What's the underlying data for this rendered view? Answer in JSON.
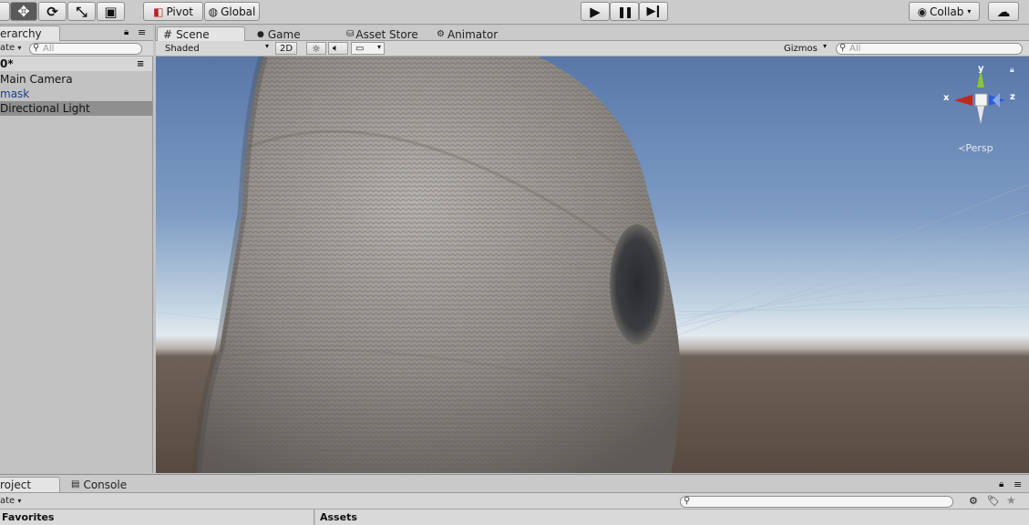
{
  "toolbar": {
    "tools": [
      {
        "name": "hand-tool",
        "glyph": "✋"
      },
      {
        "name": "move-tool",
        "glyph": "✥"
      },
      {
        "name": "rotate-tool",
        "glyph": "⟳"
      },
      {
        "name": "scale-tool",
        "glyph": "⤡"
      },
      {
        "name": "rect-tool",
        "glyph": "▣"
      }
    ],
    "pivot_label": "Pivot",
    "global_label": "Global",
    "play_glyph": "▶",
    "pause_glyph": "❚❚",
    "step_glyph": "▶❙",
    "collab_label": "Collab",
    "cloud_glyph": "☁"
  },
  "hierarchy": {
    "tab_label": "erarchy",
    "create_label": "ate",
    "search_placeholder": "All",
    "scene_name": "0*",
    "items": [
      {
        "label": "Main Camera",
        "selected": false,
        "prefab": false
      },
      {
        "label": "mask",
        "selected": false,
        "prefab": true
      },
      {
        "label": "Directional Light",
        "selected": true,
        "prefab": false
      }
    ]
  },
  "scene_view": {
    "tabs": [
      {
        "label": "Scene",
        "icon": "#",
        "active": true
      },
      {
        "label": "Game",
        "icon": "●",
        "active": false
      },
      {
        "label": "Asset Store",
        "icon": "⛁",
        "active": false
      },
      {
        "label": "Animator",
        "icon": "⚙",
        "active": false
      }
    ],
    "shading_mode": "Shaded",
    "mode_2d_label": "2D",
    "gizmos_label": "Gizmos",
    "search_placeholder": "All",
    "gizmo": {
      "y_label": "y",
      "x_label": "x",
      "z_label": "z",
      "persp_label": "Persp"
    },
    "colors": {
      "sky_top": "#5877a8",
      "sky_horizon": "#dfe8ee",
      "ground": "#5e5248",
      "gizmo_x": "#c0281e",
      "gizmo_y": "#8ac43a",
      "gizmo_z": "#2f5fd8"
    }
  },
  "bottom": {
    "tabs": [
      {
        "label": "roject",
        "active": true
      },
      {
        "label": "Console",
        "active": false
      }
    ],
    "create_label": "ate",
    "favorites_label": "Favorites",
    "assets_label": "Assets"
  }
}
